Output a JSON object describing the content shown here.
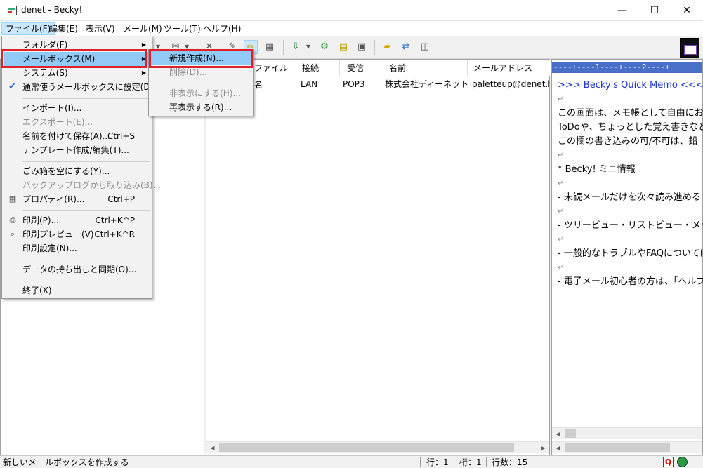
{
  "window": {
    "title": "denet - Becky!",
    "controls": {
      "minimize": "—",
      "maximize": "☐",
      "close": "✕"
    }
  },
  "menubar": [
    {
      "label": "ファイル(F)"
    },
    {
      "label": "編集(E)"
    },
    {
      "label": "表示(V)"
    },
    {
      "label": "メール(M)"
    },
    {
      "label": "ツール(T)"
    },
    {
      "label": "ヘルプ(H)"
    }
  ],
  "toolbar_icons": [
    "dropdown-arrow",
    "reply-all-icon",
    "dropdown-arrow",
    "delete-icon",
    "compose-icon",
    "edit-pencil-icon",
    "properties-icon",
    "receive-icon",
    "dropdown-arrow",
    "filter-icon",
    "memo-icon",
    "archive-icon",
    "folder-icon",
    "send-receive-icon",
    "layout-icon",
    "becky-brand-icon"
  ],
  "file_menu": {
    "items": [
      {
        "label": "フォルダ(F)",
        "submenu": true
      },
      {
        "label": "メールボックス(M)",
        "submenu": true,
        "highlighted": true
      },
      {
        "label": "システム(S)",
        "submenu": true
      },
      {
        "label": "通常使うメールボックスに設定(D)",
        "checked": true
      },
      {
        "label": "インポート(I)..."
      },
      {
        "label": "エクスポート(E)...",
        "disabled": true
      },
      {
        "label": "名前を付けて保存(A)...",
        "shortcut": "Ctrl+S"
      },
      {
        "label": "テンプレート作成/編集(T)..."
      },
      {
        "label": "ごみ箱を空にする(Y)..."
      },
      {
        "label": "バックアップログから取り込み(B)...",
        "disabled": true
      },
      {
        "label": "プロパティ(R)...",
        "shortcut": "Ctrl+P"
      },
      {
        "label": "印刷(P)...",
        "shortcut": "Ctrl+K^P"
      },
      {
        "label": "印刷プレビュー(V)",
        "shortcut": "Ctrl+K^R"
      },
      {
        "label": "印刷設定(N)..."
      },
      {
        "label": "データの持ち出しと同期(O)..."
      },
      {
        "label": "終了(X)"
      }
    ]
  },
  "mailbox_submenu": {
    "items": [
      {
        "label": "新規作成(N)...",
        "highlighted": true
      },
      {
        "label": "削除(D)...",
        "disabled": true
      },
      {
        "label": "非表示にする(H)...",
        "disabled": true
      },
      {
        "label": "再表示する(R)..."
      }
    ]
  },
  "list": {
    "columns": [
      "ファイル名",
      "接続",
      "受信",
      "名前",
      "メールアドレス"
    ],
    "rows": [
      [
        "",
        "LAN",
        "POP3",
        "株式会社ディーネット",
        "paletteup@denet.biz"
      ]
    ]
  },
  "memo": {
    "ruler": "----+----1----+----2----+",
    "lines": [
      ">>> Becky's Quick Memo <<<",
      "この画面は、メモ帳として自由にお使",
      "ToDoや、ちょっとした覚え書きなどに",
      "この欄の書き込みの可/不可は、鉛",
      "* Becky! ミニ情報",
      "- 未読メールだけを次々読み進める",
      "- ツリービュー・リストビュー・メッセージ",
      "- 一般的なトラブルやFAQについては",
      "- 電子メール初心者の方は、「ヘルプ"
    ],
    "return_mark": "↵"
  },
  "statusbar": {
    "message": "新しいメールボックスを作成する",
    "line": "行：1",
    "column": "桁：1",
    "line_count": "行数：15"
  }
}
